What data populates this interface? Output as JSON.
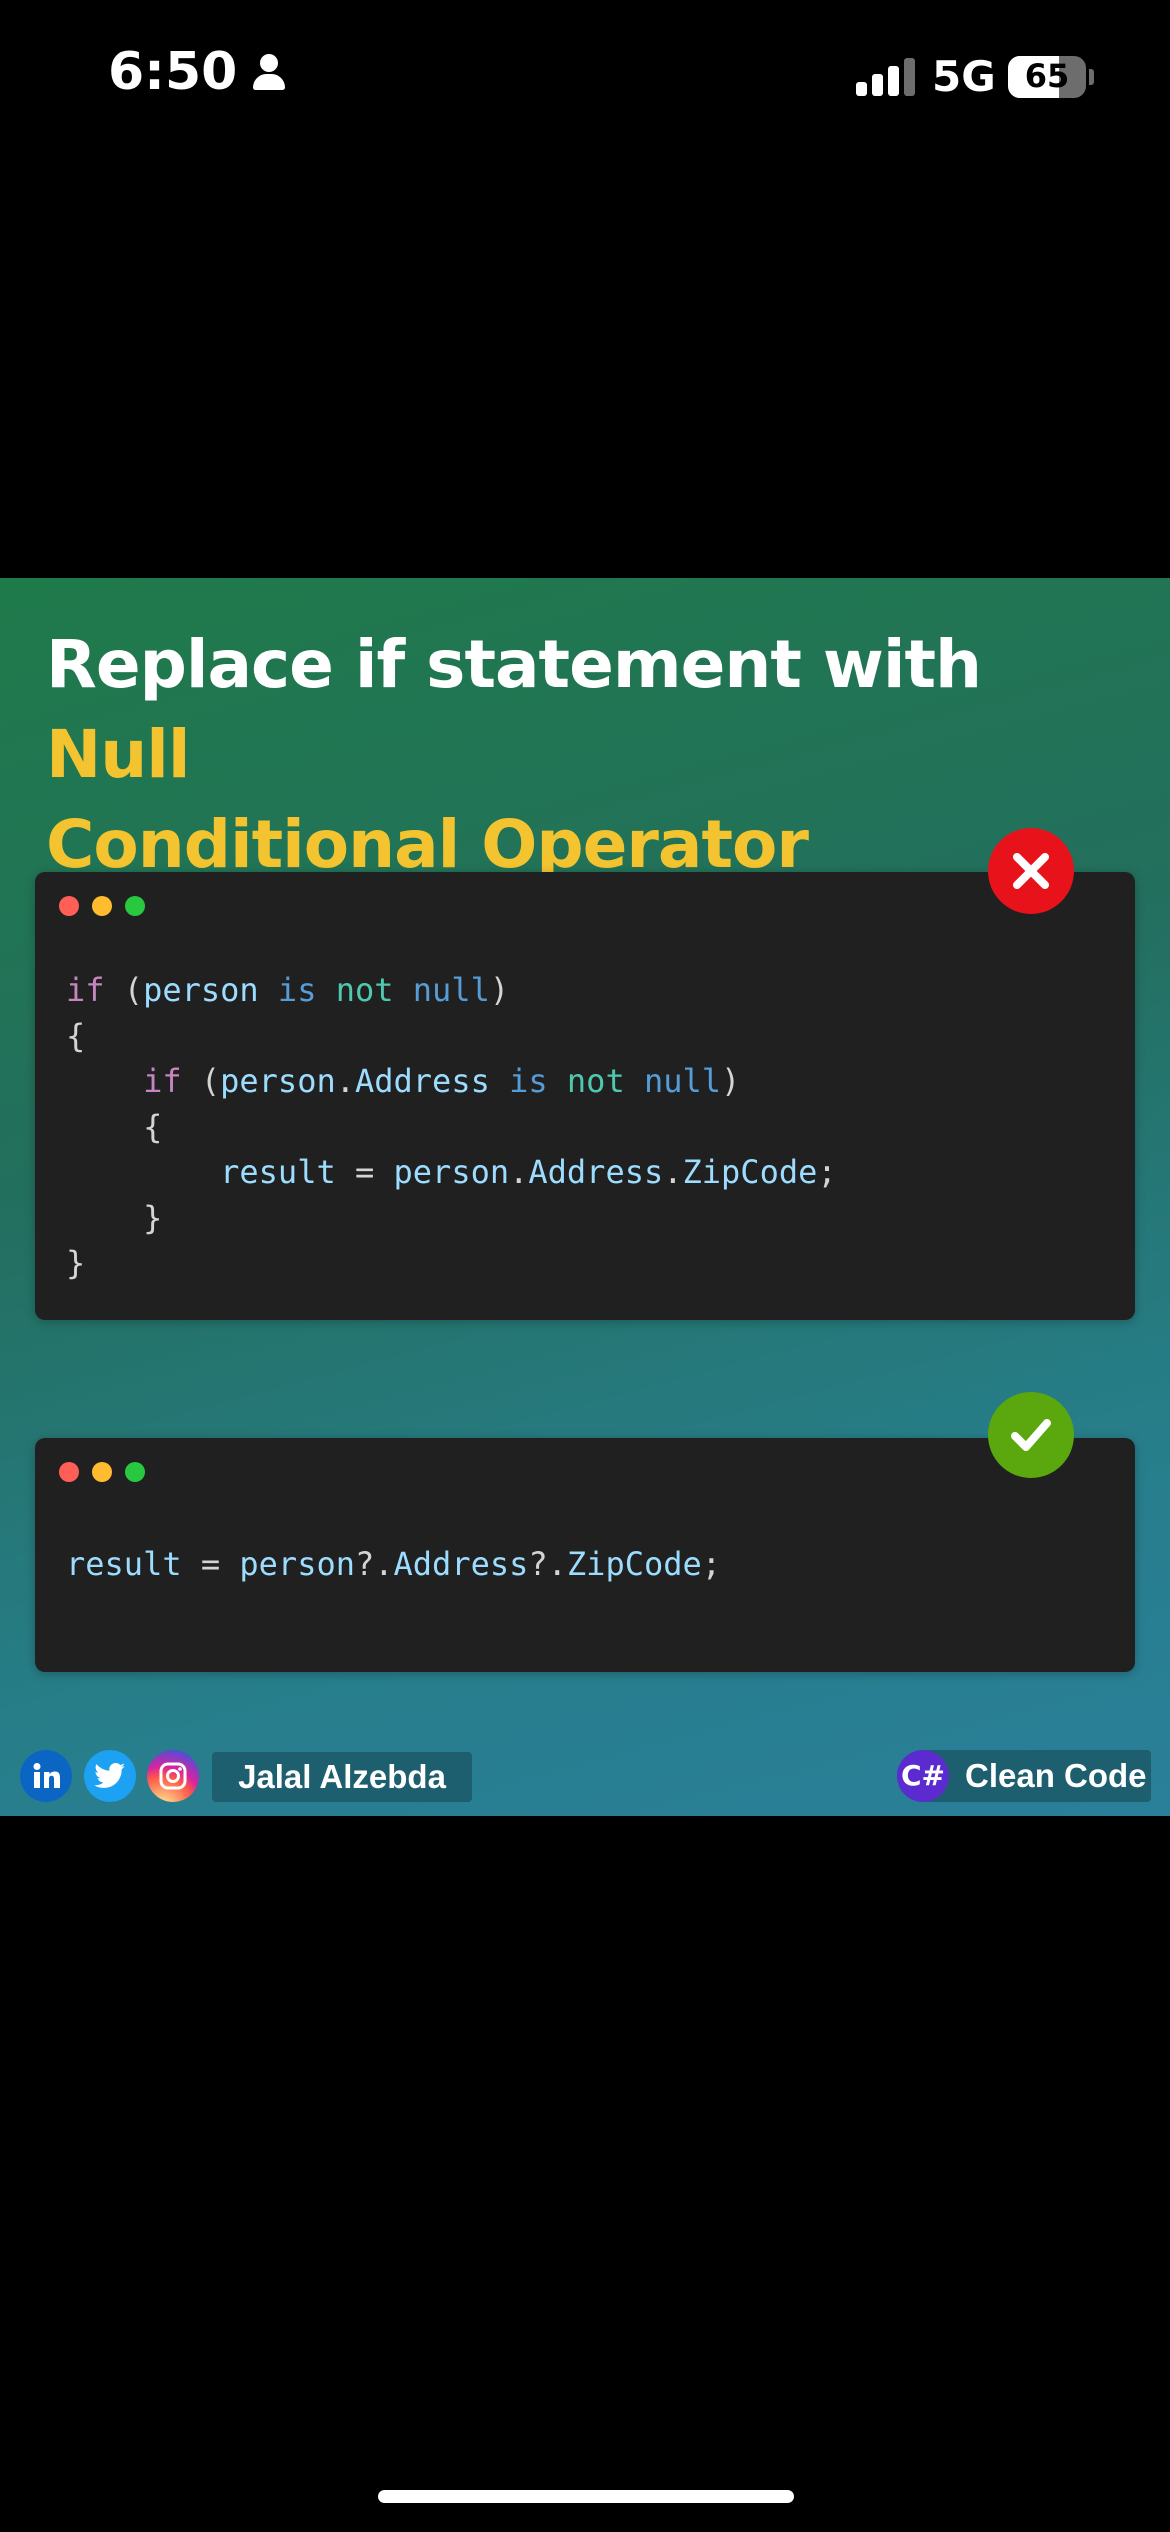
{
  "status_bar": {
    "time": "6:50",
    "network": "5G",
    "battery": "65",
    "battery_level": 0.65,
    "signal_bars": 3
  },
  "post": {
    "title_plain": "Replace if statement with ",
    "title_accent_1": "Null",
    "title_accent_2": "Conditional Operator",
    "accent_color": "#f4c430",
    "bad_example": {
      "lines": [
        [
          {
            "t": "if",
            "c": "kw"
          },
          {
            "t": " (",
            "c": "pn"
          },
          {
            "t": "person",
            "c": "id"
          },
          {
            "t": " ",
            "c": "pn"
          },
          {
            "t": "is",
            "c": "nl"
          },
          {
            "t": " ",
            "c": "pn"
          },
          {
            "t": "not",
            "c": "op"
          },
          {
            "t": " ",
            "c": "pn"
          },
          {
            "t": "null",
            "c": "nl"
          },
          {
            "t": ")",
            "c": "pn"
          }
        ],
        [
          {
            "t": "{",
            "c": "pn"
          }
        ],
        [
          {
            "t": "    ",
            "c": "pn"
          },
          {
            "t": "if",
            "c": "kw"
          },
          {
            "t": " (",
            "c": "pn"
          },
          {
            "t": "person",
            "c": "id"
          },
          {
            "t": ".",
            "c": "pn"
          },
          {
            "t": "Address",
            "c": "id"
          },
          {
            "t": " ",
            "c": "pn"
          },
          {
            "t": "is",
            "c": "nl"
          },
          {
            "t": " ",
            "c": "pn"
          },
          {
            "t": "not",
            "c": "op"
          },
          {
            "t": " ",
            "c": "pn"
          },
          {
            "t": "null",
            "c": "nl"
          },
          {
            "t": ")",
            "c": "pn"
          }
        ],
        [
          {
            "t": "    {",
            "c": "pn"
          }
        ],
        [
          {
            "t": "        ",
            "c": "pn"
          },
          {
            "t": "result",
            "c": "id"
          },
          {
            "t": " = ",
            "c": "pn"
          },
          {
            "t": "person",
            "c": "id"
          },
          {
            "t": ".",
            "c": "pn"
          },
          {
            "t": "Address",
            "c": "id"
          },
          {
            "t": ".",
            "c": "pn"
          },
          {
            "t": "ZipCode",
            "c": "id"
          },
          {
            "t": ";",
            "c": "pn"
          }
        ],
        [
          {
            "t": "    }",
            "c": "pn"
          }
        ],
        [
          {
            "t": "}",
            "c": "pn"
          }
        ]
      ],
      "badge_icon": "x-mark-icon",
      "badge_color": "#e8121a"
    },
    "good_example": {
      "lines": [
        [
          {
            "t": "result",
            "c": "id"
          },
          {
            "t": " = ",
            "c": "pn"
          },
          {
            "t": "person",
            "c": "id"
          },
          {
            "t": "?.",
            "c": "pn"
          },
          {
            "t": "Address",
            "c": "id"
          },
          {
            "t": "?.",
            "c": "pn"
          },
          {
            "t": "ZipCode",
            "c": "id"
          },
          {
            "t": ";",
            "c": "pn"
          }
        ]
      ],
      "badge_icon": "checkmark-icon",
      "badge_color": "#5aa80e"
    }
  },
  "footer": {
    "social_icons": [
      "linkedin-icon",
      "twitter-icon",
      "instagram-icon"
    ],
    "author": "Jalal Alzebda",
    "brand_icon_text": "C#",
    "brand": "Clean Code"
  }
}
